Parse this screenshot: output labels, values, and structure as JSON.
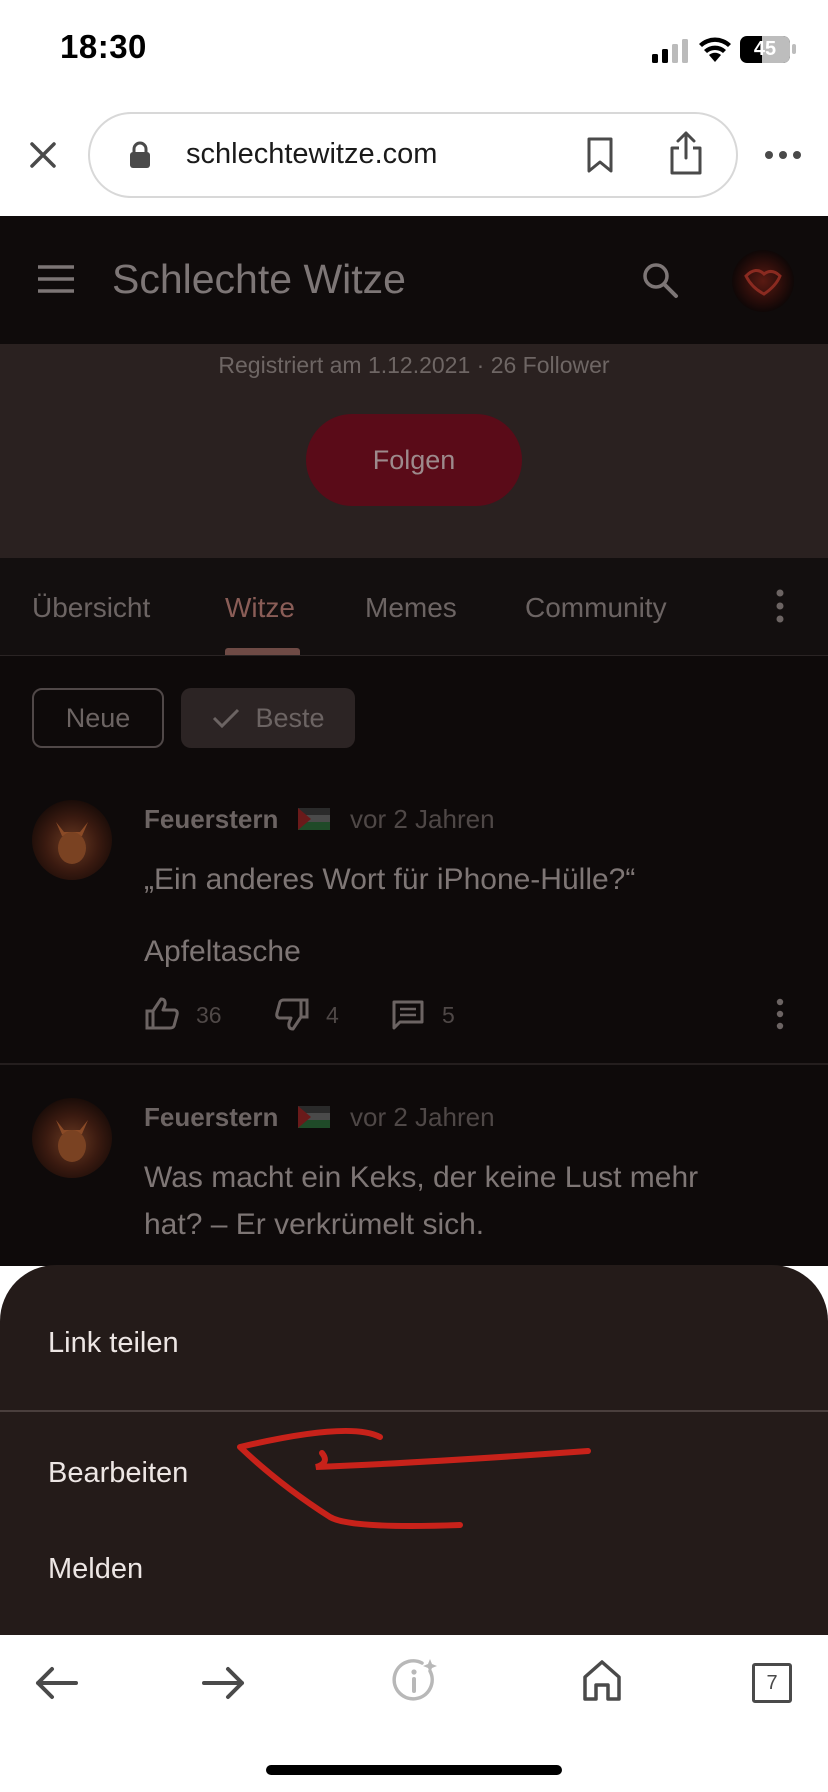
{
  "status_bar": {
    "time": "18:30",
    "battery": "45"
  },
  "browser": {
    "url": "schlechtewitze.com",
    "tab_count": "7"
  },
  "app": {
    "title": "Schlechte Witze"
  },
  "profile": {
    "registered": "Registriert am 1.12.2021 · 26 Follower",
    "follow_label": "Folgen"
  },
  "tabs": [
    {
      "label": "Übersicht"
    },
    {
      "label": "Witze"
    },
    {
      "label": "Memes"
    },
    {
      "label": "Community"
    }
  ],
  "filters": {
    "neue": "Neue",
    "beste": "Beste"
  },
  "posts": [
    {
      "user": "Feuerstern",
      "time": "vor 2 Jahren",
      "line1": "„Ein anderes Wort für iPhone-Hülle?“",
      "line2": "Apfeltasche",
      "likes": "36",
      "dislikes": "4",
      "comments": "5"
    },
    {
      "user": "Feuerstern",
      "time": "vor 2 Jahren",
      "line1": "Was macht ein Keks, der keine Lust mehr",
      "line2": "hat? – Er verkrümelt sich."
    }
  ],
  "sheet": {
    "share": "Link teilen",
    "edit": "Bearbeiten",
    "report": "Melden"
  },
  "colors": {
    "accent_follow": "#5a0b18",
    "annotation": "#c8221a"
  }
}
